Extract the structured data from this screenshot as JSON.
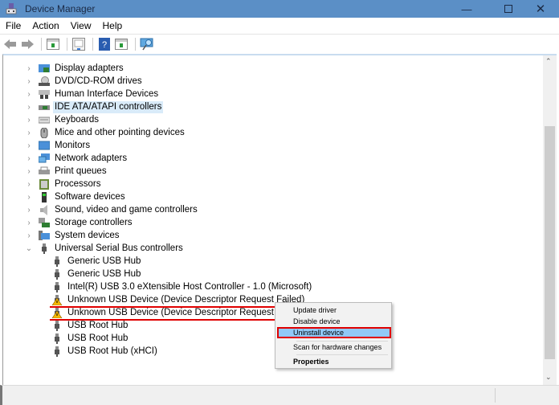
{
  "window": {
    "title": "Device Manager",
    "minimize_icon": "minimize-icon",
    "maximize_icon": "maximize-icon",
    "close_icon": "close-icon"
  },
  "menu": [
    "File",
    "Action",
    "View",
    "Help"
  ],
  "toolbar": [
    "back-icon",
    "forward-icon",
    "show-hide-console-tree-icon",
    "properties-icon",
    "help-icon",
    "action-pane-icon",
    "scan-hardware-icon"
  ],
  "tree": {
    "categories": [
      {
        "label": "Display adapters",
        "icon": "display-adapter-icon",
        "expanded": false
      },
      {
        "label": "DVD/CD-ROM drives",
        "icon": "dvd-drive-icon",
        "expanded": false
      },
      {
        "label": "Human Interface Devices",
        "icon": "hid-icon",
        "expanded": false
      },
      {
        "label": "IDE ATA/ATAPI controllers",
        "icon": "ide-controller-icon",
        "expanded": false,
        "selected": true
      },
      {
        "label": "Keyboards",
        "icon": "keyboard-icon",
        "expanded": false
      },
      {
        "label": "Mice and other pointing devices",
        "icon": "mouse-icon",
        "expanded": false
      },
      {
        "label": "Monitors",
        "icon": "monitor-icon",
        "expanded": false
      },
      {
        "label": "Network adapters",
        "icon": "network-adapter-icon",
        "expanded": false
      },
      {
        "label": "Print queues",
        "icon": "printer-icon",
        "expanded": false
      },
      {
        "label": "Processors",
        "icon": "processor-icon",
        "expanded": false
      },
      {
        "label": "Software devices",
        "icon": "software-device-icon",
        "expanded": false
      },
      {
        "label": "Sound, video and game controllers",
        "icon": "speaker-icon",
        "expanded": false
      },
      {
        "label": "Storage controllers",
        "icon": "storage-controller-icon",
        "expanded": false
      },
      {
        "label": "System devices",
        "icon": "system-device-icon",
        "expanded": false
      },
      {
        "label": "Universal Serial Bus controllers",
        "icon": "usb-icon",
        "expanded": true
      }
    ],
    "usb_children": [
      {
        "label": "Generic USB Hub",
        "warning": false
      },
      {
        "label": "Generic USB Hub",
        "warning": false
      },
      {
        "label": "Intel(R) USB 3.0 eXtensible Host Controller - 1.0 (Microsoft)",
        "warning": false
      },
      {
        "label": "Unknown USB Device (Device Descriptor Request Failed)",
        "warning": true
      },
      {
        "label": "Unknown USB Device (Device Descriptor Request Failed)",
        "warning": true
      },
      {
        "label": "USB Root Hub",
        "warning": false
      },
      {
        "label": "USB Root Hub",
        "warning": false
      },
      {
        "label": "USB Root Hub (xHCI)",
        "warning": false
      }
    ]
  },
  "context_menu": {
    "items": [
      "Update driver",
      "Disable device",
      "Uninstall device",
      "Scan for hardware changes",
      "Properties"
    ],
    "highlighted": "Uninstall device",
    "bold": "Properties"
  },
  "colors": {
    "titlebar": "#5b8fc6",
    "selection": "#d9ebf9",
    "highlight": "#91c9f7",
    "annotation": "#e00000"
  }
}
